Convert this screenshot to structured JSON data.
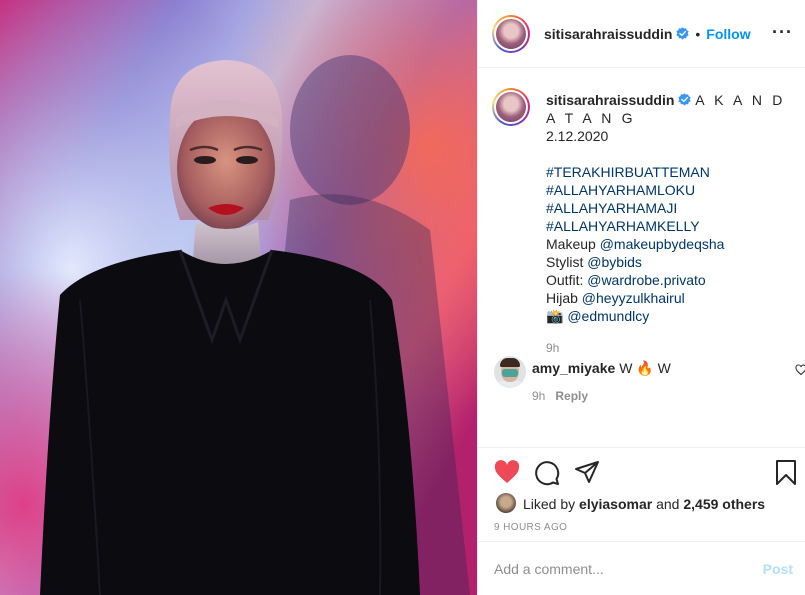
{
  "post": {
    "username": "sitisarahraissuddin",
    "follow_label": "Follow",
    "more_icon": "···"
  },
  "caption": {
    "username": "sitisarahraissuddin",
    "text": "A K A N D A T A N G",
    "date": "2.12.2020",
    "hashtags": [
      "#TERAKHIRBUATTEMAN",
      "#ALLAHYARHAMLOKU",
      "#ALLAHYARHAMAJI",
      "#ALLAHYARHAMKELLY"
    ],
    "credits": [
      {
        "label": "Makeup ",
        "mention": "@makeupbydeqsha"
      },
      {
        "label": "Stylist ",
        "mention": "@bybids"
      },
      {
        "label": "Outfit: ",
        "mention": "@wardrobe.privato"
      },
      {
        "label": "Hijab ",
        "mention": "@heyyzulkhairul"
      },
      {
        "label": "📸 ",
        "mention": "@edmundlcy"
      }
    ],
    "time": "9h"
  },
  "comment": {
    "username": "amy_miyake",
    "text": "W 🔥 W",
    "time": "9h",
    "reply_label": "Reply"
  },
  "likes": {
    "prefix": "Liked by ",
    "user": "elyiasomar",
    "middle": " and ",
    "others": "2,459 others"
  },
  "posted_ago": "9 HOURS AGO",
  "add_comment": {
    "placeholder": "Add a comment...",
    "post_label": "Post"
  },
  "colors": {
    "accent": "#0095f6",
    "like": "#ed4956",
    "link": "#00376b",
    "muted": "#8e8e8e"
  }
}
